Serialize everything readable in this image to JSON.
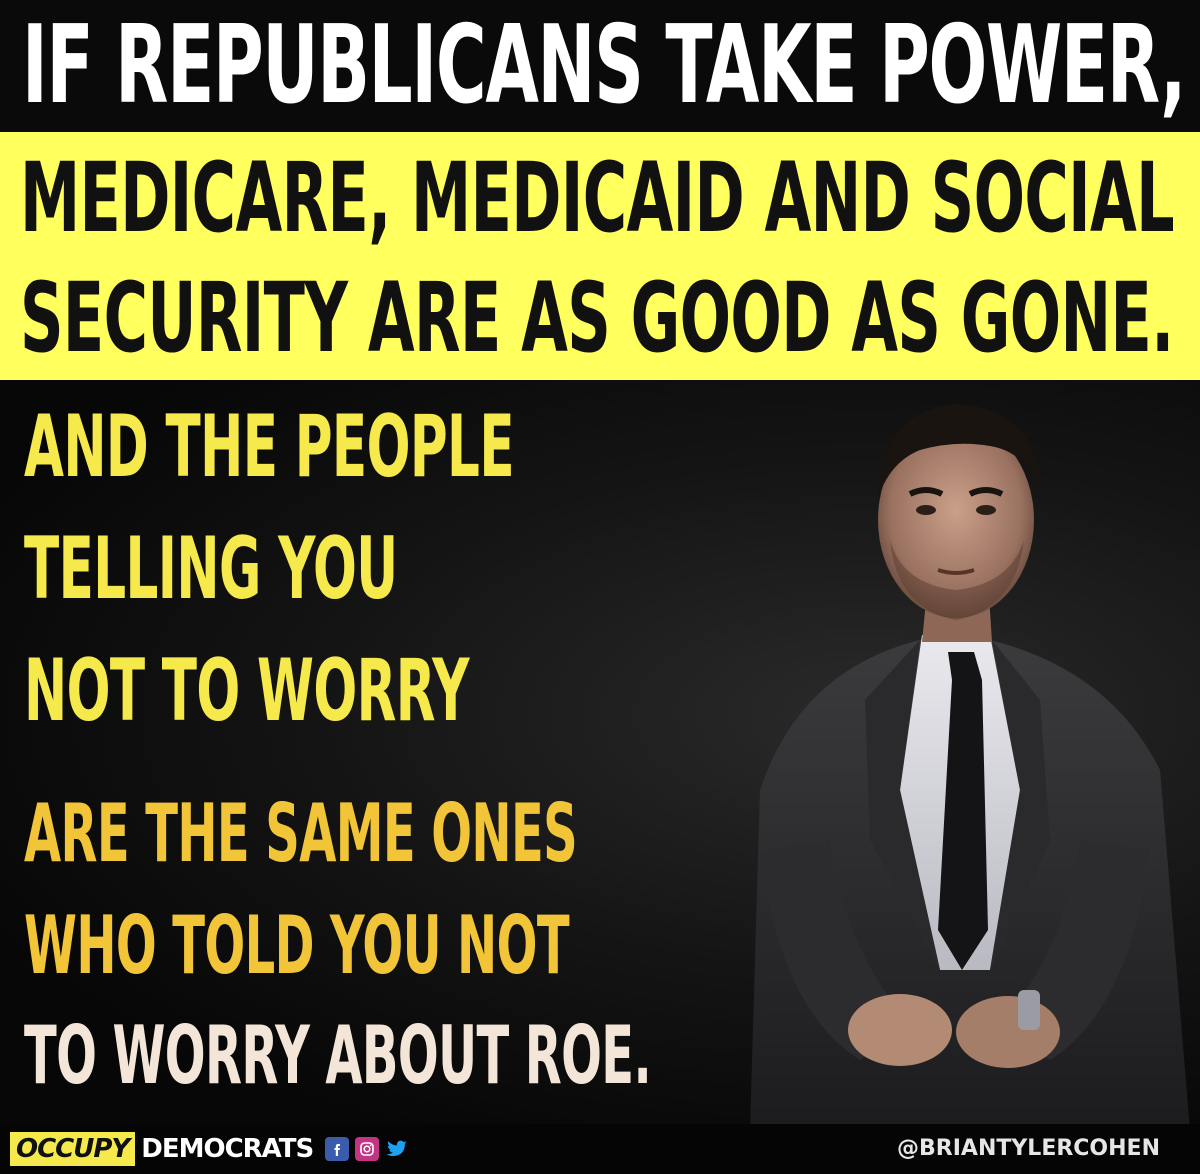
{
  "headline": {
    "line_top": "IF REPUBLICANS TAKE POWER,",
    "yellow_line_1": "MEDICARE, MEDICAID AND SOCIAL",
    "yellow_line_2": "SECURITY ARE AS GOOD AS GONE."
  },
  "body": {
    "line_1": "AND THE PEOPLE",
    "line_2": "TELLING YOU",
    "line_3": "NOT TO WORRY",
    "line_4": "ARE THE SAME ONES",
    "line_5": "WHO TOLD YOU NOT",
    "line_6": "TO WORRY ABOUT ROE."
  },
  "footer": {
    "brand_part_1": "OCCUPY",
    "brand_part_2": "DEMOCRATS",
    "social_icons": [
      "facebook-icon",
      "instagram-icon",
      "twitter-icon"
    ],
    "handle": "@BRIANTYLERCOHEN"
  },
  "colors": {
    "yellow": "#ffff5e",
    "body_yellow": "#f6e94b",
    "body_gold": "#f2c437",
    "dark_bg": "#0b0b0b"
  }
}
